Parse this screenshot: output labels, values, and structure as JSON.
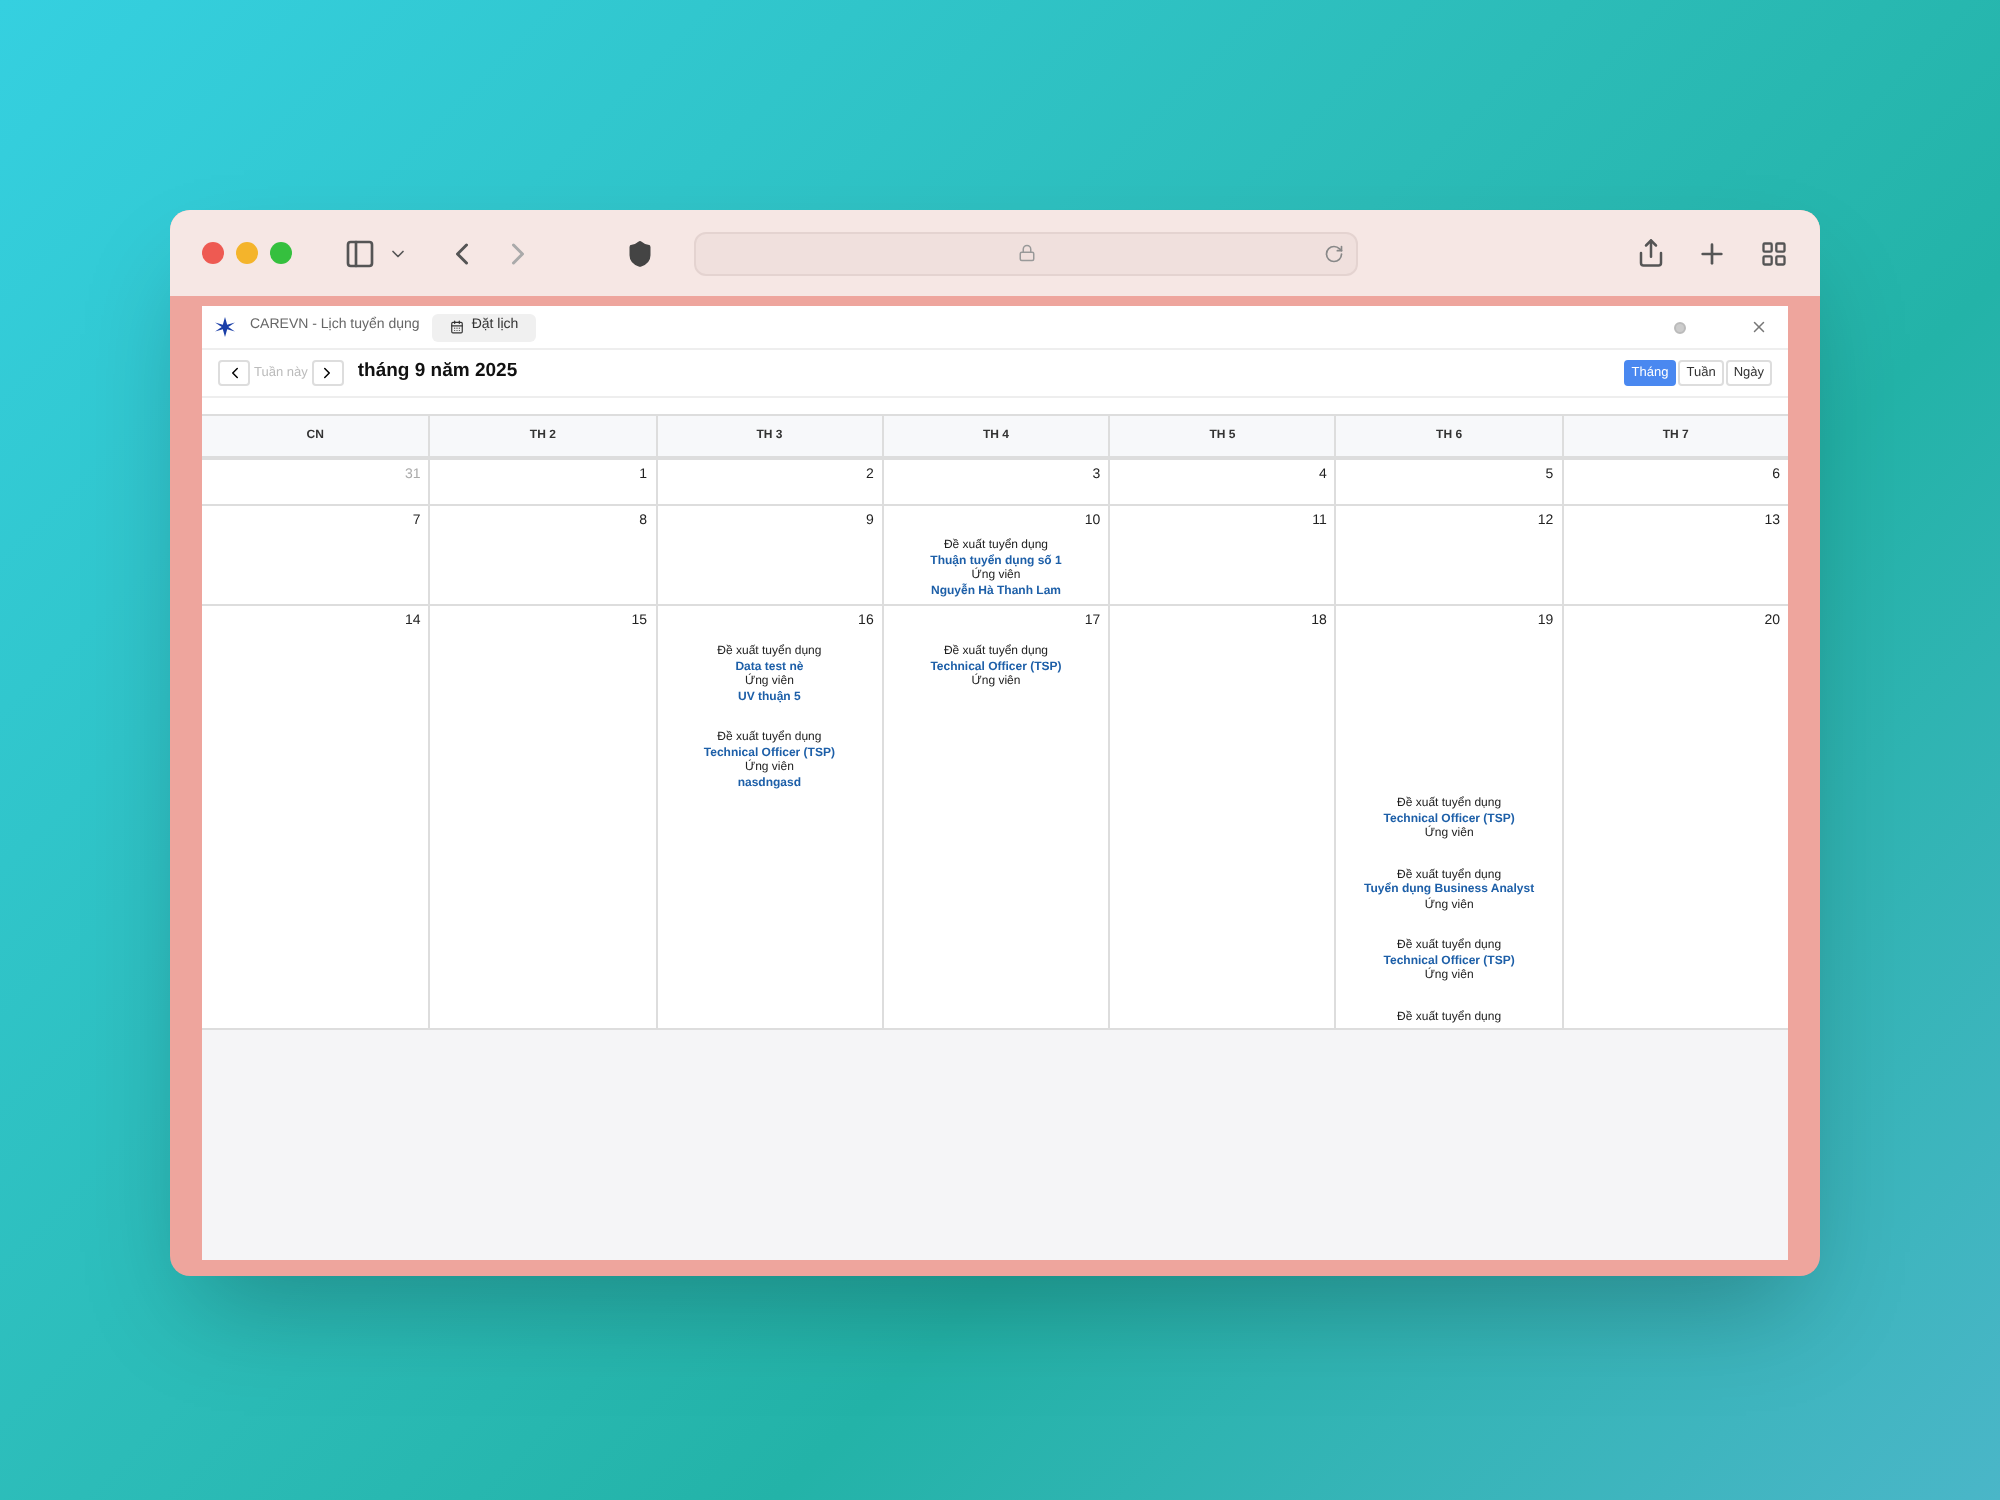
{
  "app": {
    "title": "CAREVN - Lịch tuyển dụng",
    "tabs": [
      {
        "label": "Đặt lịch",
        "selected": true
      }
    ]
  },
  "toolbar": {
    "today": {
      "label": "Tuần này",
      "disabled": true
    },
    "period": "tháng 9 năm 2025",
    "views": [
      {
        "label": "Tháng",
        "selected": true
      },
      {
        "label": "Tuần",
        "selected": false
      },
      {
        "label": "Ngày",
        "selected": false
      }
    ]
  },
  "calendar": {
    "weekdays": [
      "CN",
      "TH 2",
      "TH 3",
      "TH 4",
      "TH 5",
      "TH 6",
      "TH 7"
    ],
    "weeks": [
      {
        "days": [
          {
            "date": "31",
            "outside": true
          },
          {
            "date": "1",
            "outside": false
          },
          {
            "date": "2",
            "outside": false
          },
          {
            "date": "3",
            "outside": false
          },
          {
            "date": "4",
            "outside": false
          },
          {
            "date": "5",
            "outside": false
          },
          {
            "date": "6",
            "outside": false
          }
        ]
      },
      {
        "days": [
          {
            "date": "7",
            "outside": false
          },
          {
            "date": "8",
            "outside": false
          },
          {
            "date": "9",
            "outside": false
          },
          {
            "date": "10",
            "outside": false,
            "events": [
              {
                "lines": [
                  {
                    "kind": "label",
                    "text": "Đề xuất tuyển dụng"
                  },
                  {
                    "kind": "link",
                    "text": "Thuận tuyển dụng số 1"
                  },
                  {
                    "kind": "label",
                    "text": "Ứng viên"
                  },
                  {
                    "kind": "link",
                    "text": "Nguyễn Hà Thanh Lam"
                  }
                ]
              }
            ]
          },
          {
            "date": "11",
            "outside": false
          },
          {
            "date": "12",
            "outside": false
          },
          {
            "date": "13",
            "outside": false
          }
        ]
      },
      {
        "days": [
          {
            "date": "14",
            "outside": false
          },
          {
            "date": "15",
            "outside": false
          },
          {
            "date": "16",
            "outside": false,
            "events": [
              {
                "lines": [
                  {
                    "kind": "label",
                    "text": "Đề xuất tuyển dụng"
                  },
                  {
                    "kind": "link",
                    "text": "Data test nè"
                  },
                  {
                    "kind": "label",
                    "text": "Ứng viên"
                  },
                  {
                    "kind": "link",
                    "text": "UV thuận 5"
                  }
                ]
              },
              {
                "lines": [
                  {
                    "kind": "label",
                    "text": "Đề xuất tuyển dụng"
                  },
                  {
                    "kind": "link",
                    "text": "Technical Officer (TSP)"
                  },
                  {
                    "kind": "label",
                    "text": "Ứng viên"
                  },
                  {
                    "kind": "link",
                    "text": "nasdngasd"
                  }
                ]
              }
            ]
          },
          {
            "date": "17",
            "outside": false,
            "events": [
              {
                "lines": [
                  {
                    "kind": "label",
                    "text": "Đề xuất tuyển dụng"
                  },
                  {
                    "kind": "link",
                    "text": "Technical Officer (TSP)"
                  },
                  {
                    "kind": "label",
                    "text": "Ứng viên"
                  }
                ]
              }
            ]
          },
          {
            "date": "18",
            "outside": false
          },
          {
            "date": "19",
            "outside": false,
            "events": [
              {
                "lines": [
                  {
                    "kind": "label",
                    "text": "Đề xuất tuyển dụng"
                  },
                  {
                    "kind": "link",
                    "text": "Technical Officer (TSP)"
                  },
                  {
                    "kind": "label",
                    "text": "Ứng viên"
                  }
                ]
              },
              {
                "lines": [
                  {
                    "kind": "label",
                    "text": "Đề xuất tuyển dụng"
                  },
                  {
                    "kind": "link",
                    "text": "Tuyển dụng Business Analyst"
                  },
                  {
                    "kind": "label",
                    "text": "Ứng viên"
                  }
                ]
              },
              {
                "lines": [
                  {
                    "kind": "label",
                    "text": "Đề xuất tuyển dụng"
                  },
                  {
                    "kind": "link",
                    "text": "Technical Officer (TSP)"
                  },
                  {
                    "kind": "label",
                    "text": "Ứng viên"
                  }
                ]
              },
              {
                "lines": [
                  {
                    "kind": "label",
                    "text": "Đề xuất tuyển dụng"
                  }
                ]
              }
            ]
          },
          {
            "date": "20",
            "outside": false
          }
        ]
      }
    ]
  }
}
